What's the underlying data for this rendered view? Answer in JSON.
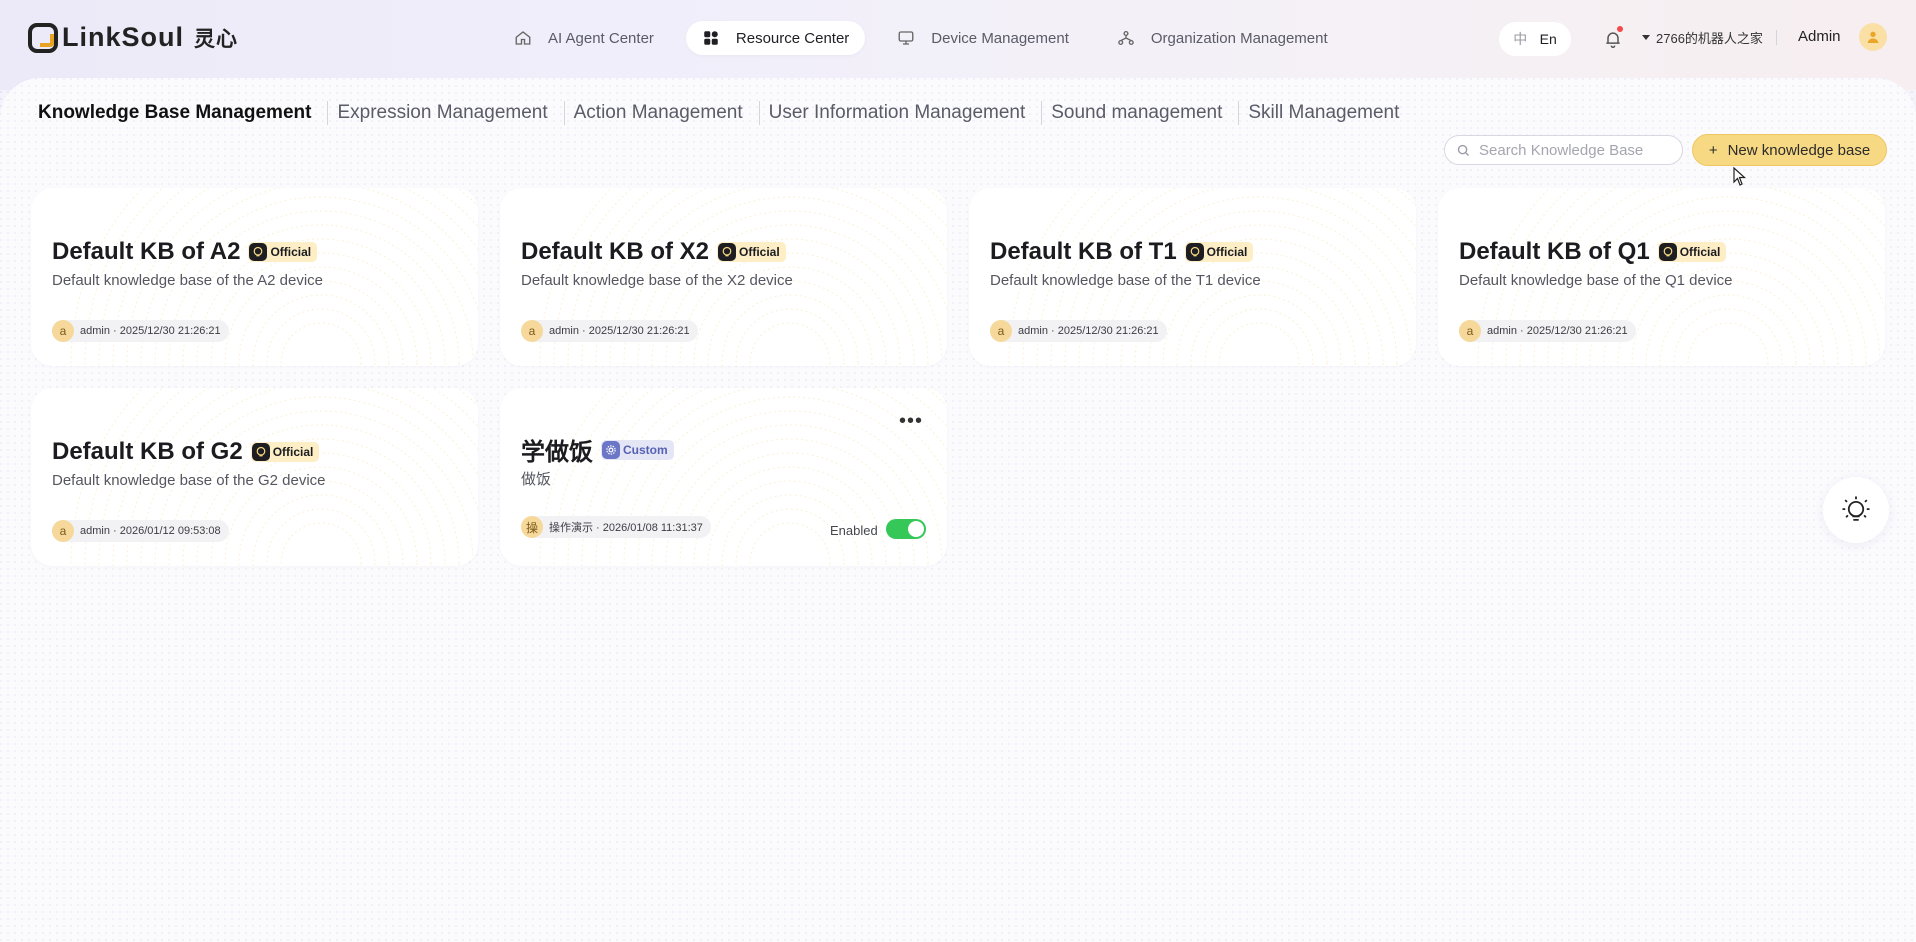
{
  "brand": {
    "name": "LinkSoul",
    "name_cn": "灵心"
  },
  "nav": [
    {
      "label": "AI Agent Center",
      "icon": "home-icon",
      "active": false
    },
    {
      "label": "Resource Center",
      "icon": "grid-icon",
      "active": true
    },
    {
      "label": "Device Management",
      "icon": "monitor-icon",
      "active": false
    },
    {
      "label": "Organization Management",
      "icon": "org-tree-icon",
      "active": false
    }
  ],
  "lang": {
    "zh": "中",
    "en": "En"
  },
  "workspace": "2766的机器人之家",
  "user": {
    "name": "Admin"
  },
  "tabs": [
    {
      "label": "Knowledge Base Management",
      "active": true
    },
    {
      "label": "Expression Management"
    },
    {
      "label": "Action Management"
    },
    {
      "label": "User Information Management"
    },
    {
      "label": "Sound management"
    },
    {
      "label": "Skill Management"
    }
  ],
  "search": {
    "placeholder": "Search Knowledge Base",
    "value": ""
  },
  "new_button": {
    "plus": "+",
    "label": "New knowledge base"
  },
  "cards": [
    {
      "title": "Default KB of A2",
      "badge": "Official",
      "desc": "Default knowledge base of the A2 device",
      "avatar": "a",
      "meta": "admin · 2025/12/30 21:26:21"
    },
    {
      "title": "Default KB of X2",
      "badge": "Official",
      "desc": "Default knowledge base of the X2 device",
      "avatar": "a",
      "meta": "admin · 2025/12/30 21:26:21"
    },
    {
      "title": "Default KB of T1",
      "badge": "Official",
      "desc": "Default knowledge base of the T1 device",
      "avatar": "a",
      "meta": "admin · 2025/12/30 21:26:21"
    },
    {
      "title": "Default KB of Q1",
      "badge": "Official",
      "desc": "Default knowledge base of the Q1 device",
      "avatar": "a",
      "meta": "admin · 2025/12/30 21:26:21"
    },
    {
      "title": "Default KB of G2",
      "badge": "Official",
      "desc": "Default knowledge base of the G2 device",
      "avatar": "a",
      "meta": "admin · 2026/01/12 09:53:08"
    },
    {
      "title": "学做饭",
      "badge": "Custom",
      "desc": "做饭",
      "avatar": "操",
      "meta": "操作演示 · 2026/01/08 11:31:37",
      "more": "•••",
      "status_label": "Enabled",
      "enabled": true
    }
  ],
  "colors": {
    "accent": "#f8d983",
    "toggle_on": "#35c757",
    "official_badge": "#fdeec5",
    "custom_badge": "#e4e6f5"
  }
}
